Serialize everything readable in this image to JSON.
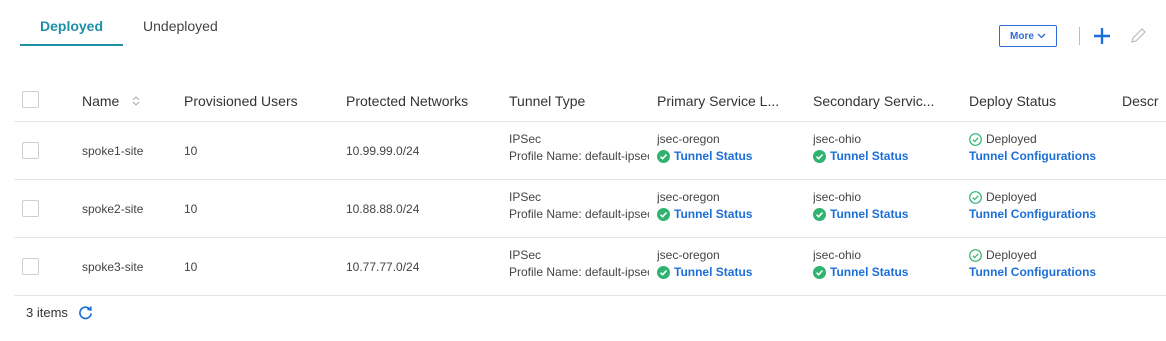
{
  "tabs": [
    {
      "label": "Deployed",
      "active": true
    },
    {
      "label": "Undeployed",
      "active": false
    }
  ],
  "toolbar": {
    "more_label": "More",
    "icons": [
      "chevron-down-icon",
      "plus-icon",
      "pencil-icon"
    ]
  },
  "columns": {
    "name": "Name",
    "users": "Provisioned Users",
    "networks": "Protected Networks",
    "tunnel_type": "Tunnel Type",
    "primary": "Primary Service L...",
    "secondary": "Secondary Servic...",
    "deploy": "Deploy Status",
    "description": "Descr"
  },
  "rows": [
    {
      "name": "spoke1-site",
      "users": "10",
      "networks": "10.99.99.0/24",
      "tunnel_type": "IPSec",
      "profile": "Profile Name: default-ipsec",
      "primary": "jsec-oregon",
      "primary_status": "Tunnel Status",
      "secondary": "jsec-ohio",
      "secondary_status": "Tunnel Status",
      "deploy": "Deployed",
      "deploy_link": "Tunnel Configurations"
    },
    {
      "name": "spoke2-site",
      "users": "10",
      "networks": "10.88.88.0/24",
      "tunnel_type": "IPSec",
      "profile": "Profile Name: default-ipsec",
      "primary": "jsec-oregon",
      "primary_status": "Tunnel Status",
      "secondary": "jsec-ohio",
      "secondary_status": "Tunnel Status",
      "deploy": "Deployed",
      "deploy_link": "Tunnel Configurations"
    },
    {
      "name": "spoke3-site",
      "users": "10",
      "networks": "10.77.77.0/24",
      "tunnel_type": "IPSec",
      "profile": "Profile Name: default-ipsec",
      "primary": "jsec-oregon",
      "primary_status": "Tunnel Status",
      "secondary": "jsec-ohio",
      "secondary_status": "Tunnel Status",
      "deploy": "Deployed",
      "deploy_link": "Tunnel Configurations"
    }
  ],
  "footer": {
    "count_label": "3 items"
  },
  "colors": {
    "accent": "#1f8fa8",
    "link": "#1d6fd8",
    "success": "#2fb36f"
  }
}
